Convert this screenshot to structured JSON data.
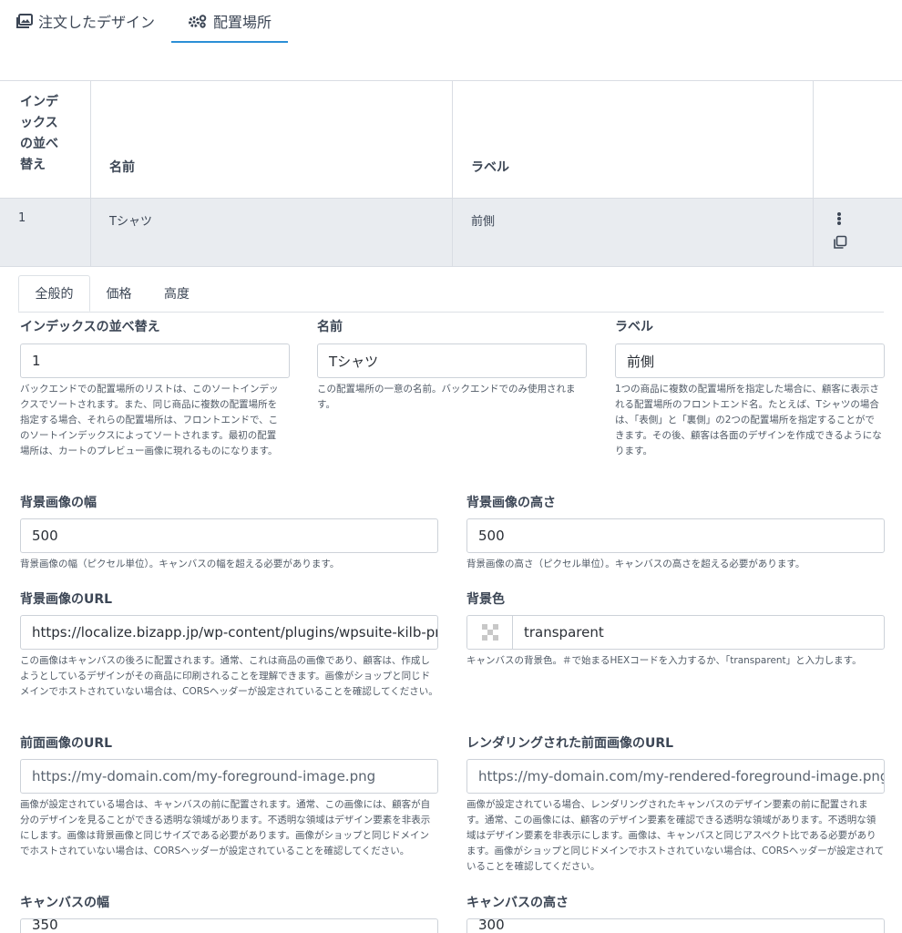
{
  "top_tabs": [
    {
      "label": "注文したデザイン",
      "icon": "image-gallery-icon"
    },
    {
      "label": "配置場所",
      "icon": "gears-icon"
    }
  ],
  "table": {
    "headers": {
      "index_lines": [
        "インデ",
        "ックス",
        "の並べ",
        "替え"
      ],
      "name": "名前",
      "label": "ラベル"
    },
    "rows": [
      {
        "index": "1",
        "name": "Tシャツ",
        "label": "前側"
      }
    ]
  },
  "inner_tabs": [
    "全般的",
    "価格",
    "高度"
  ],
  "fields": {
    "sort_index": {
      "label": "インデックスの並べ替え",
      "value": "1",
      "help": "バックエンドでの配置場所のリストは、このソートインデックスでソートされます。また、同じ商品に複数の配置場所を指定する場合、それらの配置場所は、フロントエンドで、このソートインデックスによってソートされます。最初の配置場所は、カートのプレビュー画像に現れるものになります。"
    },
    "name": {
      "label": "名前",
      "value": "Tシャツ",
      "help": "この配置場所の一意の名前。バックエンドでのみ使用されます。"
    },
    "label": {
      "label": "ラベル",
      "value": "前側",
      "help": "1つの商品に複数の配置場所を指定した場合に、顧客に表示される配置場所のフロントエンド名。たとえば、Tシャツの場合は、「表側」と「裏側」の2つの配置場所を指定することができます。その後、顧客は各面のデザインを作成できるようになります。"
    },
    "bg_width": {
      "label": "背景画像の幅",
      "value": "500",
      "help": "背景画像の幅（ピクセル単位）。キャンバスの幅を超える必要があります。"
    },
    "bg_height": {
      "label": "背景画像の高さ",
      "value": "500",
      "help": "背景画像の高さ（ピクセル単位）。キャンバスの高さを超える必要があります。"
    },
    "bg_url": {
      "label": "背景画像のURL",
      "value": "https://localize.bizapp.jp/wp-content/plugins/wpsuite-kilb-product",
      "help": "この画像はキャンバスの後ろに配置されます。通常、これは商品の画像であり、顧客は、作成しようとしているデザインがその商品に印刷されることを理解できます。画像がショップと同じドメインでホストされていない場合は、CORSヘッダーが設定されていることを確認してください。"
    },
    "bg_color": {
      "label": "背景色",
      "value": "transparent",
      "help": "キャンバスの背景色。＃で始まるHEXコードを入力するか、「transparent」と入力します。"
    },
    "fg_url": {
      "label": "前面画像のURL",
      "value": "https://my-domain.com/my-foreground-image.png",
      "help": "画像が設定されている場合は、キャンバスの前に配置されます。通常、この画像には、顧客が自分のデザインを見ることができる透明な領域があります。不透明な領域はデザイン要素を非表示にします。画像は背景画像と同じサイズである必要があります。画像がショップと同じドメインでホストされていない場合は、CORSヘッダーが設定されていることを確認してください。"
    },
    "rendered_fg_url": {
      "label": "レンダリングされた前面画像のURL",
      "value": "https://my-domain.com/my-rendered-foreground-image.png",
      "help": "画像が設定されている場合、レンダリングされたキャンバスのデザイン要素の前に配置されます。通常、この画像には、顧客のデザイン要素を確認できる透明な領域があります。不透明な領域はデザイン要素を非表示にします。画像は、キャンバスと同じアスペクト比である必要があります。画像がショップと同じドメインでホストされていない場合は、CORSヘッダーが設定されていることを確認してください。"
    },
    "canvas_width": {
      "label": "キャンバスの幅",
      "value": "350"
    },
    "canvas_height": {
      "label": "キャンバスの高さ",
      "value": "300"
    }
  },
  "colors": {
    "accent": "#2b8fd6",
    "row_bg": "#e9ecf0",
    "border": "#d9dde3"
  }
}
